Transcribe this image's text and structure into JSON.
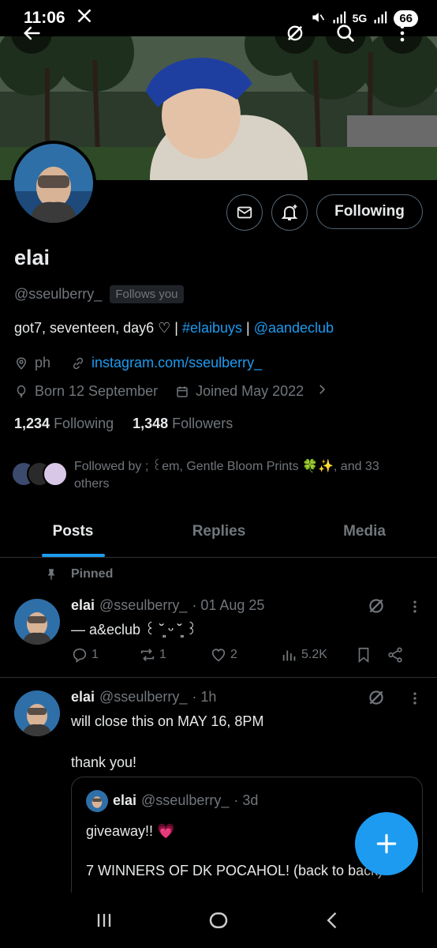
{
  "status_bar": {
    "time": "11:06",
    "app_icon": "x-logo-icon",
    "network": "5G",
    "battery": "66"
  },
  "profile": {
    "name": "elai",
    "handle": "@sseulberry_",
    "follows_you": "Follows you",
    "bio_prefix": "got7, seventeen, day6 ♡ | ",
    "bio_hashtag": "#elaibuys",
    "bio_sep": " | ",
    "bio_mention": "@aandeclub",
    "location": "ph",
    "website": "instagram.com/sseulberry_",
    "born": "Born 12 September",
    "joined": "Joined May 2022",
    "following_count": "1,234",
    "following_label": "Following",
    "followers_count": "1,348",
    "followers_label": "Followers",
    "followed_by": "Followed by ; ꒰em, Gentle Bloom Prints 🍀✨, and 33 others",
    "follow_button": "Following"
  },
  "tabs": [
    {
      "label": "Posts",
      "active": true
    },
    {
      "label": "Replies",
      "active": false
    },
    {
      "label": "Media",
      "active": false
    }
  ],
  "posts": [
    {
      "pinned_label": "Pinned",
      "name": "elai",
      "handle": "@sseulberry_",
      "time": "· 01 Aug 25",
      "text": "— a&eclub ꒰ ˘͈ ᵕ ˘͈ ꒱",
      "replies": "1",
      "reposts": "1",
      "likes": "2",
      "views": "5.2K"
    },
    {
      "name": "elai",
      "handle": "@sseulberry_",
      "time": "· 1h",
      "text": "will close this on MAY 16, 8PM\n\nthank you!",
      "quote": {
        "name": "elai",
        "handle": "@sseulberry_",
        "time": "· 3d",
        "text_line1": "giveaway!! 💗",
        "text_line2": "7 WINNERS OF DK POCAHOL! (back to back)"
      }
    }
  ],
  "colors": {
    "accent": "#1d9bf0",
    "muted": "#71767b",
    "text": "#e7e9ea",
    "border": "#2f3336"
  }
}
